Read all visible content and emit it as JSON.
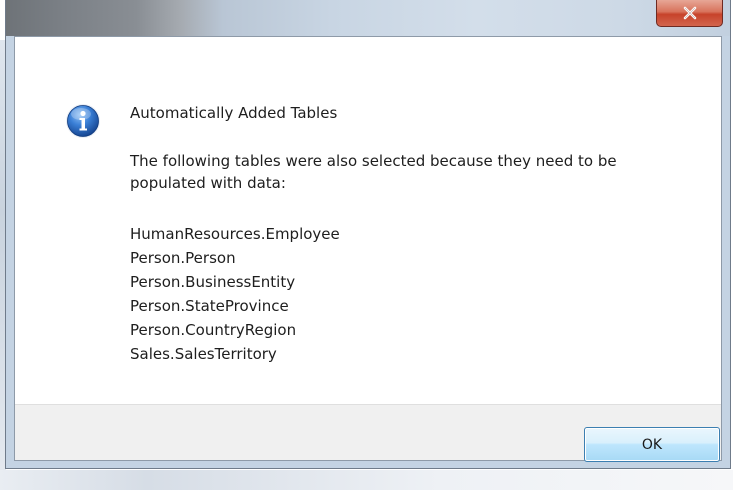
{
  "window": {
    "title": "",
    "close_icon": "close-icon"
  },
  "dialog": {
    "icon": "information-icon",
    "main_instruction": "Automatically Added Tables",
    "message": "The following tables were also selected because they need to be populated with data:",
    "tables": [
      "HumanResources.Employee",
      "Person.Person",
      "Person.BusinessEntity",
      "Person.StateProvince",
      "Person.CountryRegion",
      "Sales.SalesTerritory"
    ]
  },
  "buttons": {
    "ok_label": "OK"
  },
  "colors": {
    "close_button": "#c7432b",
    "info_icon": "#1d5fb6",
    "ok_border": "#3c7fb1"
  }
}
